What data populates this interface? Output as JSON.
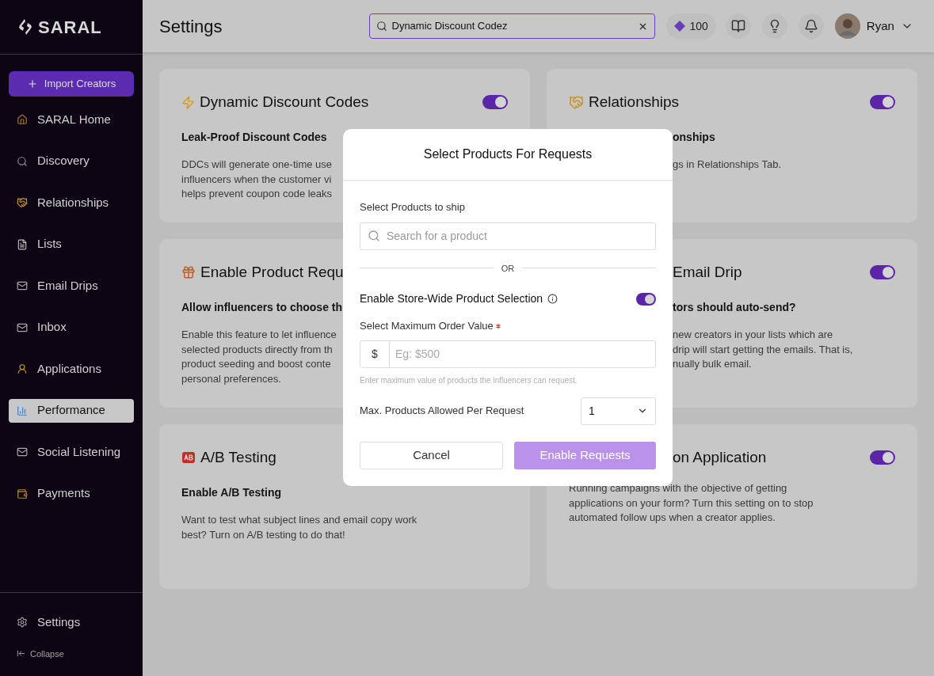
{
  "sidebar": {
    "logo": "SARAL",
    "import_button": "Import Creators",
    "items": [
      {
        "label": "SARAL Home",
        "selected": false
      },
      {
        "label": "Discovery",
        "selected": false
      },
      {
        "label": "Relationships",
        "selected": false
      },
      {
        "label": "Lists",
        "selected": false
      },
      {
        "label": "Email Drips",
        "selected": false
      },
      {
        "label": "Inbox",
        "selected": false
      },
      {
        "label": "Applications",
        "selected": false
      },
      {
        "label": "Performance",
        "selected": true
      },
      {
        "label": "Social Listening",
        "selected": false
      },
      {
        "label": "Payments",
        "selected": false
      }
    ],
    "settings": "Settings",
    "collapse": "Collapse"
  },
  "topbar": {
    "title": "Settings",
    "search": {
      "value": "Dynamic Discount Codez"
    },
    "points": "100",
    "user": "Ryan"
  },
  "cards": [
    {
      "title": "Dynamic Discount Codes",
      "on": true,
      "title_covered": false,
      "body_covered": false,
      "subtitle": "Leak-Proof Discount Codes",
      "lines": [
        "DDCs will generate one-time use",
        "influencers when the customer vi",
        "helps prevent coupon code leaks"
      ]
    },
    {
      "title": "Relationships",
      "on": true,
      "title_covered": false,
      "body_covered": true,
      "subtitle": "onships",
      "lines": [
        "gs in Relationships Tab."
      ]
    },
    {
      "title": "Enable Product Requ",
      "title_covered": false,
      "body_covered": false,
      "subtitle": "Allow influencers to choose th",
      "lines": [
        "Enable this feature to let influence",
        "selected products directly from th",
        "product seeding and boost conte",
        "personal preferences."
      ]
    },
    {
      "title": "Email Drip",
      "on": true,
      "title_covered": true,
      "body_covered": true,
      "subtitle": "tors should auto-send?",
      "lines": [
        "new creators in your lists which are",
        "drip will start getting the emails. That is,",
        "nually bulk email."
      ]
    },
    {
      "title": "A/B Testing",
      "title_covered": false,
      "body_covered": false,
      "subtitle": "Enable A/B Testing",
      "lines": [
        "Want to test what subject lines and email copy work",
        "best? Turn on A/B testing to do that!"
      ]
    },
    {
      "title": "on Application",
      "on": true,
      "title_covered": true,
      "body_covered": false,
      "lines": [
        "Running campaigns with the objective of getting",
        "applications on your form? Turn this setting on to stop",
        "automated follow ups when a creator applies."
      ]
    }
  ],
  "modal": {
    "title": "Select Products For Requests",
    "products_label": "Select Products to ship",
    "search_placeholder": "Search for a product",
    "or_text": "OR",
    "store_wide": {
      "label": "Enable Store-Wide Product Selection",
      "on": true
    },
    "max_order": {
      "label": "Select Maximum Order Value",
      "required": true,
      "prefix": "$",
      "placeholder": "Eg: $500",
      "hint": "Enter maximum value of products the influencers can request."
    },
    "max_products": {
      "label": "Max. Products Allowed Per Request",
      "value": "1"
    },
    "cancel": "Cancel",
    "confirm": {
      "label": "Enable Requests",
      "disabled": true
    }
  }
}
